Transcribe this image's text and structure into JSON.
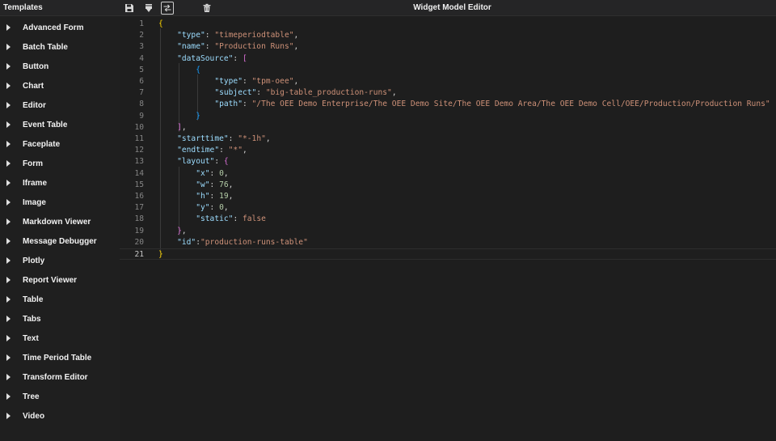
{
  "header": {
    "sidebar_title": "Templates",
    "editor_title": "Widget Model Editor",
    "tools": [
      "save-icon",
      "download-icon",
      "swap-icon",
      "trash-icon"
    ]
  },
  "sidebar": {
    "items": [
      {
        "label": "Advanced Form"
      },
      {
        "label": "Batch Table"
      },
      {
        "label": "Button"
      },
      {
        "label": "Chart"
      },
      {
        "label": "Editor"
      },
      {
        "label": "Event Table"
      },
      {
        "label": "Faceplate"
      },
      {
        "label": "Form"
      },
      {
        "label": "Iframe"
      },
      {
        "label": "Image"
      },
      {
        "label": "Markdown Viewer"
      },
      {
        "label": "Message Debugger"
      },
      {
        "label": "Plotly"
      },
      {
        "label": "Report Viewer"
      },
      {
        "label": "Table"
      },
      {
        "label": "Tabs"
      },
      {
        "label": "Text"
      },
      {
        "label": "Time Period Table"
      },
      {
        "label": "Transform Editor"
      },
      {
        "label": "Tree"
      },
      {
        "label": "Video"
      }
    ]
  },
  "editor": {
    "current_line": 21,
    "lines": [
      {
        "num": "1",
        "tokens": [
          [
            "b1",
            "{"
          ]
        ]
      },
      {
        "num": "2",
        "tokens": [
          [
            "p",
            "    "
          ],
          [
            "k",
            "\"type\""
          ],
          [
            "p",
            ": "
          ],
          [
            "s",
            "\"timeperiodtable\""
          ],
          [
            "p",
            ","
          ]
        ]
      },
      {
        "num": "3",
        "tokens": [
          [
            "p",
            "    "
          ],
          [
            "k",
            "\"name\""
          ],
          [
            "p",
            ": "
          ],
          [
            "s",
            "\"Production Runs\""
          ],
          [
            "p",
            ","
          ]
        ]
      },
      {
        "num": "4",
        "tokens": [
          [
            "p",
            "    "
          ],
          [
            "k",
            "\"dataSource\""
          ],
          [
            "p",
            ": "
          ],
          [
            "b2",
            "["
          ]
        ]
      },
      {
        "num": "5",
        "tokens": [
          [
            "p",
            "        "
          ],
          [
            "b3",
            "{"
          ]
        ]
      },
      {
        "num": "6",
        "tokens": [
          [
            "p",
            "            "
          ],
          [
            "k",
            "\"type\""
          ],
          [
            "p",
            ": "
          ],
          [
            "s",
            "\"tpm-oee\""
          ],
          [
            "p",
            ","
          ]
        ]
      },
      {
        "num": "7",
        "tokens": [
          [
            "p",
            "            "
          ],
          [
            "k",
            "\"subject\""
          ],
          [
            "p",
            ": "
          ],
          [
            "s",
            "\"big-table_production-runs\""
          ],
          [
            "p",
            ","
          ]
        ]
      },
      {
        "num": "8",
        "tokens": [
          [
            "p",
            "            "
          ],
          [
            "k",
            "\"path\""
          ],
          [
            "p",
            ": "
          ],
          [
            "s",
            "\"/The OEE Demo Enterprise/The OEE Demo Site/The OEE Demo Area/The OEE Demo Cell/OEE/Production/Production Runs\""
          ]
        ]
      },
      {
        "num": "9",
        "tokens": [
          [
            "p",
            "        "
          ],
          [
            "b3",
            "}"
          ]
        ]
      },
      {
        "num": "10",
        "tokens": [
          [
            "p",
            "    "
          ],
          [
            "b2",
            "]"
          ],
          [
            "p",
            ","
          ]
        ]
      },
      {
        "num": "11",
        "tokens": [
          [
            "p",
            "    "
          ],
          [
            "k",
            "\"starttime\""
          ],
          [
            "p",
            ": "
          ],
          [
            "s",
            "\"*-1h\""
          ],
          [
            "p",
            ","
          ]
        ]
      },
      {
        "num": "12",
        "tokens": [
          [
            "p",
            "    "
          ],
          [
            "k",
            "\"endtime\""
          ],
          [
            "p",
            ": "
          ],
          [
            "s",
            "\"*\""
          ],
          [
            "p",
            ","
          ]
        ]
      },
      {
        "num": "13",
        "tokens": [
          [
            "p",
            "    "
          ],
          [
            "k",
            "\"layout\""
          ],
          [
            "p",
            ": "
          ],
          [
            "b2",
            "{"
          ]
        ]
      },
      {
        "num": "14",
        "tokens": [
          [
            "p",
            "        "
          ],
          [
            "k",
            "\"x\""
          ],
          [
            "p",
            ": "
          ],
          [
            "n",
            "0"
          ],
          [
            "p",
            ","
          ]
        ]
      },
      {
        "num": "15",
        "tokens": [
          [
            "p",
            "        "
          ],
          [
            "k",
            "\"w\""
          ],
          [
            "p",
            ": "
          ],
          [
            "n",
            "76"
          ],
          [
            "p",
            ","
          ]
        ]
      },
      {
        "num": "16",
        "tokens": [
          [
            "p",
            "        "
          ],
          [
            "k",
            "\"h\""
          ],
          [
            "p",
            ": "
          ],
          [
            "n",
            "19"
          ],
          [
            "p",
            ","
          ]
        ]
      },
      {
        "num": "17",
        "tokens": [
          [
            "p",
            "        "
          ],
          [
            "k",
            "\"y\""
          ],
          [
            "p",
            ": "
          ],
          [
            "n",
            "0"
          ],
          [
            "p",
            ","
          ]
        ]
      },
      {
        "num": "18",
        "tokens": [
          [
            "p",
            "        "
          ],
          [
            "k",
            "\"static\""
          ],
          [
            "p",
            ": "
          ],
          [
            "f",
            "false"
          ]
        ]
      },
      {
        "num": "19",
        "tokens": [
          [
            "p",
            "    "
          ],
          [
            "b2",
            "}"
          ],
          [
            "p",
            ","
          ]
        ]
      },
      {
        "num": "20",
        "tokens": [
          [
            "p",
            "    "
          ],
          [
            "k",
            "\"id\""
          ],
          [
            "p",
            ":"
          ],
          [
            "s",
            "\"production-runs-table\""
          ]
        ]
      },
      {
        "num": "21",
        "tokens": [
          [
            "b1",
            "}"
          ]
        ]
      }
    ]
  }
}
